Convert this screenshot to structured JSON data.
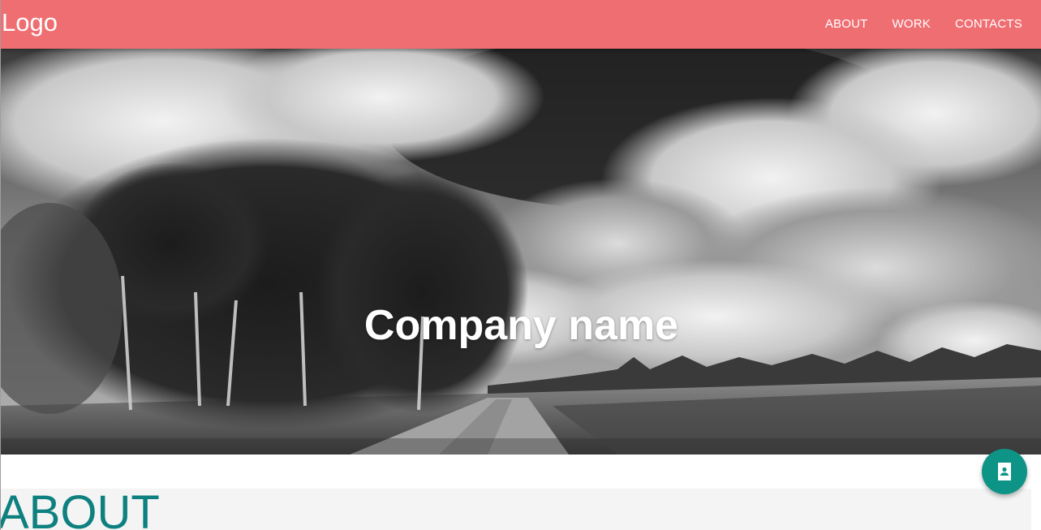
{
  "navbar": {
    "logo": "Logo",
    "links": [
      "ABOUT",
      "WORK",
      "CONTACTS"
    ],
    "background_color": "#ef6e72"
  },
  "hero": {
    "title": "Company name",
    "image_description_icon": "landscape-photo"
  },
  "about": {
    "heading": "ABOUT",
    "heading_color": "#0e8080"
  },
  "fab": {
    "icon": "contact-card-icon",
    "color": "#0e9486"
  }
}
